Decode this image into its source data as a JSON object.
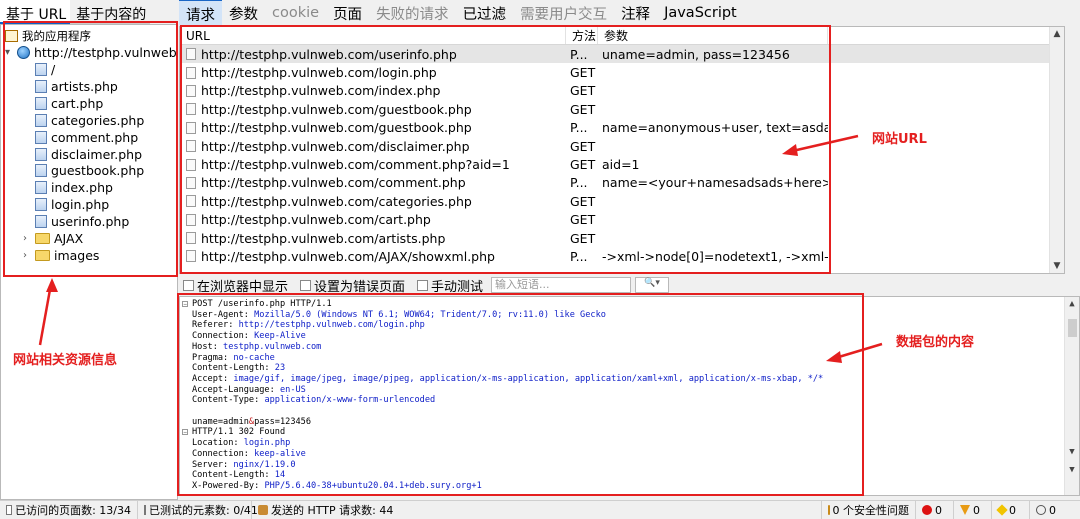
{
  "left_tabs": [
    "基于 URL",
    "基于内容的"
  ],
  "tree": {
    "root_label": "我的应用程序",
    "host_label": "http://testphp.vulnweb.c",
    "children": [
      "/",
      "artists.php",
      "cart.php",
      "categories.php",
      "comment.php",
      "disclaimer.php",
      "guestbook.php",
      "index.php",
      "login.php",
      "userinfo.php"
    ],
    "folders": [
      "AJAX",
      "images"
    ]
  },
  "top_tabs": [
    {
      "label": "请求",
      "state": "active"
    },
    {
      "label": "参数",
      "state": "normal"
    },
    {
      "label": "cookie",
      "state": "disabled"
    },
    {
      "label": "页面",
      "state": "normal"
    },
    {
      "label": "失败的请求",
      "state": "disabled"
    },
    {
      "label": "已过滤",
      "state": "normal"
    },
    {
      "label": "需要用户交互",
      "state": "disabled"
    },
    {
      "label": "注释",
      "state": "normal"
    },
    {
      "label": "JavaScript",
      "state": "normal"
    }
  ],
  "table": {
    "headers": {
      "url": "URL",
      "method": "方法",
      "params": "参数"
    },
    "rows": [
      {
        "url": "http://testphp.vulnweb.com/userinfo.php",
        "method": "P...",
        "params": "uname=admin, pass=123456"
      },
      {
        "url": "http://testphp.vulnweb.com/login.php",
        "method": "GET",
        "params": ""
      },
      {
        "url": "http://testphp.vulnweb.com/index.php",
        "method": "GET",
        "params": ""
      },
      {
        "url": "http://testphp.vulnweb.com/guestbook.php",
        "method": "GET",
        "params": ""
      },
      {
        "url": "http://testphp.vulnweb.com/guestbook.php",
        "method": "P...",
        "params": "name=anonymous+user, text=asdas..."
      },
      {
        "url": "http://testphp.vulnweb.com/disclaimer.php",
        "method": "GET",
        "params": ""
      },
      {
        "url": "http://testphp.vulnweb.com/comment.php?aid=1",
        "method": "GET",
        "params": "aid=1"
      },
      {
        "url": "http://testphp.vulnweb.com/comment.php",
        "method": "P...",
        "params": "name=<your+namesadsads+here>, ..."
      },
      {
        "url": "http://testphp.vulnweb.com/categories.php",
        "method": "GET",
        "params": ""
      },
      {
        "url": "http://testphp.vulnweb.com/cart.php",
        "method": "GET",
        "params": ""
      },
      {
        "url": "http://testphp.vulnweb.com/artists.php",
        "method": "GET",
        "params": ""
      },
      {
        "url": "http://testphp.vulnweb.com/AJAX/showxml.php",
        "method": "P...",
        "params": "->xml->node[0]=nodetext1, ->xml-..."
      }
    ]
  },
  "midbar": {
    "show_in_browser": "在浏览器中显示",
    "set_error_page": "设置为错误页面",
    "manual_test": "手动测试",
    "keyword_placeholder": "输入短语..."
  },
  "request": {
    "lines": [
      [
        {
          "t": "POST /userinfo.php HTTP/1.1",
          "c": "k"
        }
      ],
      [
        {
          "t": "User-Agent: ",
          "c": "k"
        },
        {
          "t": "Mozilla/5.0 (Windows NT 6.1; WOW64; Trident/7.0; rv:11.0) like Gecko",
          "c": "v"
        }
      ],
      [
        {
          "t": "Referer: ",
          "c": "k"
        },
        {
          "t": "http://testphp.vulnweb.com/login.php",
          "c": "v"
        }
      ],
      [
        {
          "t": "Connection: ",
          "c": "k"
        },
        {
          "t": "Keep-Alive",
          "c": "v"
        }
      ],
      [
        {
          "t": "Host: ",
          "c": "k"
        },
        {
          "t": "testphp.vulnweb.com",
          "c": "v"
        }
      ],
      [
        {
          "t": "Pragma: ",
          "c": "k"
        },
        {
          "t": "no-cache",
          "c": "v"
        }
      ],
      [
        {
          "t": "Content-Length: ",
          "c": "k"
        },
        {
          "t": "23",
          "c": "v"
        }
      ],
      [
        {
          "t": "Accept: ",
          "c": "k"
        },
        {
          "t": "image/gif, image/jpeg, image/pjpeg, application/x-ms-application, application/xaml+xml, application/x-ms-xbap, */*",
          "c": "v"
        }
      ],
      [
        {
          "t": "Accept-Language: ",
          "c": "k"
        },
        {
          "t": "en-US",
          "c": "v"
        }
      ],
      [
        {
          "t": "Content-Type: ",
          "c": "k"
        },
        {
          "t": "application/x-www-form-urlencoded",
          "c": "v"
        }
      ],
      [],
      [
        {
          "t": "uname=admin",
          "c": "k"
        },
        {
          "t": "&",
          "c": "s"
        },
        {
          "t": "pass=123456",
          "c": "k"
        }
      ],
      [
        {
          "t": "HTTP/1.1 302 Found",
          "c": "k"
        }
      ],
      [
        {
          "t": "Location: ",
          "c": "k"
        },
        {
          "t": "login.php",
          "c": "v"
        }
      ],
      [
        {
          "t": "Connection: ",
          "c": "k"
        },
        {
          "t": "keep-alive",
          "c": "v"
        }
      ],
      [
        {
          "t": "Server: ",
          "c": "k"
        },
        {
          "t": "nginx/1.19.0",
          "c": "v"
        }
      ],
      [
        {
          "t": "Content-Length: ",
          "c": "k"
        },
        {
          "t": "14",
          "c": "v"
        }
      ],
      [
        {
          "t": "X-Powered-By: ",
          "c": "k"
        },
        {
          "t": "PHP/5.6.40-38+ubuntu20.04.1+deb.sury.org+1",
          "c": "v"
        }
      ]
    ]
  },
  "status": {
    "visited": "已访问的页面数: 13/34",
    "tested": "已测试的元素数: 0/41",
    "sent": "发送的 HTTP 请求数: 44",
    "security": "0 个安全性问题",
    "red": "0",
    "orange": "0",
    "yellow": "0",
    "info": "0"
  },
  "annotations": {
    "url_label": "网站URL",
    "packet_label": "数据包的内容",
    "resource_label": "网站相关资源信息"
  }
}
